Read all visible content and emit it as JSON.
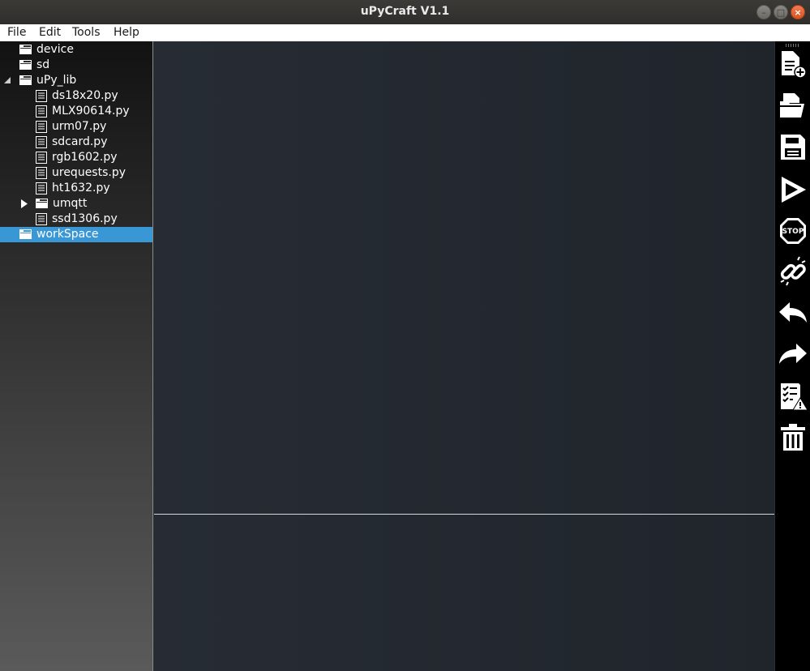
{
  "window": {
    "title": "uPyCraft V1.1"
  },
  "menu": {
    "items": [
      "File",
      "Edit",
      "Tools",
      "Help"
    ]
  },
  "tree": {
    "device": "device",
    "sd": "sd",
    "upy_lib": "uPy_lib",
    "files": [
      "ds18x20.py",
      "MLX90614.py",
      "urm07.py",
      "sdcard.py",
      "rgb1602.py",
      "urequests.py",
      "ht1632.py"
    ],
    "umqtt": "umqtt",
    "ssd1306": "ssd1306.py",
    "workspace": "workSpace",
    "selected": "workSpace"
  },
  "toolbar": {
    "tools": [
      "new-file-icon",
      "open-file-icon",
      "save-icon",
      "run-icon",
      "stop-icon",
      "connect-icon",
      "undo-icon",
      "redo-icon",
      "syntax-check-icon",
      "clear-icon"
    ]
  },
  "colors": {
    "selection": "#3a97d6",
    "editor_bg": "#252a31",
    "toolbar_bg": "#000000",
    "close_button": "#e95420"
  }
}
